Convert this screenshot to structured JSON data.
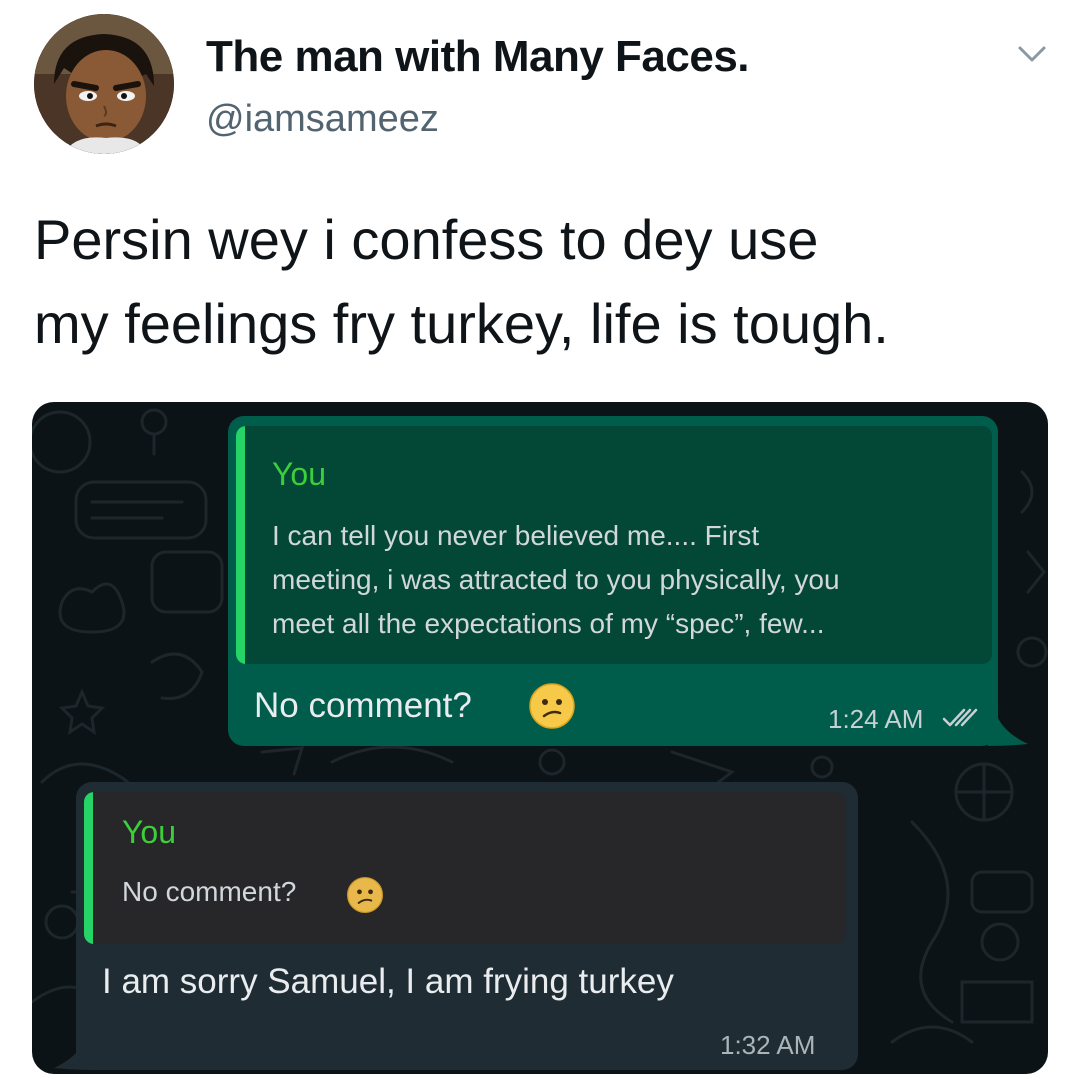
{
  "tweet": {
    "display_name": "The man with Many Faces.",
    "handle": "@iamsameez",
    "text_lines": [
      "Persin wey i confess to dey use",
      "my feelings fry turkey, life is tough."
    ],
    "icons": {
      "avatar": "cartoon-avatar",
      "menu": "chevron-down-icon"
    }
  },
  "chat": {
    "outgoing": {
      "quote_author": "You",
      "quote_lines": [
        "I can tell you never believed me.... First",
        "meeting, i was attracted to you physically, you",
        "meet all the expectations of my “spec”, few..."
      ],
      "text": "No comment?",
      "emoji": "confused-face-emoji",
      "time": "1:24 AM",
      "status_icon": "double-check-icon"
    },
    "incoming": {
      "quote_author": "You",
      "quote_text": "No comment?",
      "emoji": "confused-face-emoji",
      "text": "I am sorry Samuel, I am frying turkey",
      "time": "1:32 AM"
    },
    "colors": {
      "background": "#0c1317",
      "outgoing_bubble": "#005c4b",
      "incoming_bubble": "#202c33",
      "quote_accent": "#25d366"
    }
  }
}
